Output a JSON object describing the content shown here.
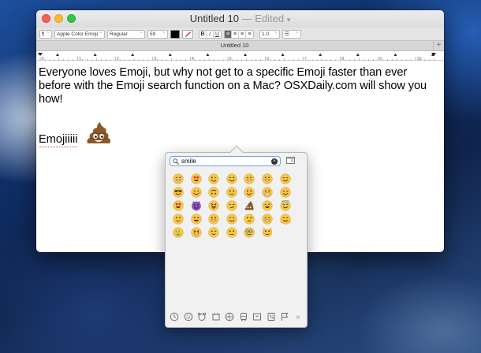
{
  "window": {
    "title": "Untitled 10",
    "title_separator": "—",
    "title_status": "Edited",
    "tab_label": "Untitled 10",
    "tab_add": "+"
  },
  "format_bar": {
    "paragraph_style": "¶",
    "font_family": "Apple Color Emoji",
    "font_style": "Regular",
    "font_size": "59",
    "bold": "B",
    "italic": "I",
    "underline": "U",
    "line_spacing": "1.0",
    "list_style": "☰"
  },
  "ruler": {
    "numbers": [
      "0",
      "1",
      "2",
      "3",
      "4",
      "5",
      "6",
      "7",
      "8",
      "9",
      "10"
    ]
  },
  "document": {
    "paragraph": "Everyone loves Emoji, but why not get to a specific Emoji faster than ever before with the Emoji search function on a Mac? OSXDaily.com will show you how!",
    "emoji_word": "Emojiiiii",
    "inserted_emoji": "pile-of-poo"
  },
  "picker": {
    "search_value": "smile",
    "search_placeholder": "Search",
    "clear_label": "×",
    "results": [
      "grinning-sweat",
      "heart-eyes",
      "wink-tongue",
      "smile-closed",
      "beaming",
      "grin-big",
      "relieved",
      "sunglasses",
      "blush",
      "upside-smile",
      "slight-smile",
      "tongue-out",
      "grin-teeth",
      "relieved",
      "heart-eyes",
      "imp",
      "tongue-squint",
      "smirk",
      "poo",
      "sweat-smile",
      "halo",
      "slight-smile",
      "grinning",
      "grin-big",
      "yum",
      "smile-shy",
      "grin",
      "hug",
      "money-mouth",
      "grin-squint",
      "pleased",
      "slight-smile",
      "nerd",
      "smiley-cat"
    ],
    "categories": [
      "recent-clock-icon",
      "smileys-icon",
      "animals-icon",
      "food-icon",
      "activity-icon",
      "travel-icon",
      "objects-icon",
      "symbols-icon",
      "flags-icon"
    ],
    "more_label": "»"
  },
  "colors": {
    "accent": "#6aa3e8",
    "emoji_yellow": "#f6c84a",
    "emoji_orange": "#e9a636",
    "poop_brown": "#8b5a2b",
    "imp_purple": "#8a4fb6",
    "spellcheck_red": "#d04a4a"
  }
}
